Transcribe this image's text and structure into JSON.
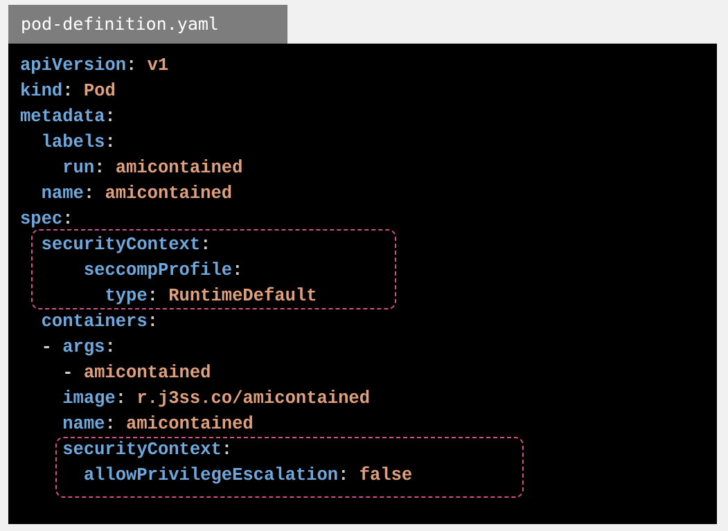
{
  "file_tab": {
    "label": "pod-definition.yaml"
  },
  "colors": {
    "key": "#6fa8dc",
    "value": "#e0a07e",
    "punct": "#d0d0d0",
    "panel_bg": "#000000",
    "tab_bg": "#7d7d7d",
    "highlight": "#d44f8e"
  },
  "code_lines": [
    {
      "indent": "",
      "key": "apiVersion",
      "sep": ":",
      "value": " v1"
    },
    {
      "indent": "",
      "key": "kind",
      "sep": ":",
      "value": " Pod"
    },
    {
      "indent": "",
      "key": "metadata",
      "sep": ":",
      "value": ""
    },
    {
      "indent": "  ",
      "key": "labels",
      "sep": ":",
      "value": ""
    },
    {
      "indent": "    ",
      "key": "run",
      "sep": ":",
      "value": " amicontained"
    },
    {
      "indent": "  ",
      "key": "name",
      "sep": ":",
      "value": " amicontained"
    },
    {
      "indent": "",
      "key": "spec",
      "sep": ":",
      "value": ""
    },
    {
      "indent": "  ",
      "key": "securityContext",
      "sep": ":",
      "value": ""
    },
    {
      "indent": "      ",
      "key": "seccompProfile",
      "sep": ":",
      "value": ""
    },
    {
      "indent": "        ",
      "key": "type",
      "sep": ":",
      "value": " RuntimeDefault"
    },
    {
      "indent": "  ",
      "key": "containers",
      "sep": ":",
      "value": ""
    },
    {
      "indent": "  - ",
      "key": "args",
      "sep": ":",
      "value": ""
    },
    {
      "indent": "    - ",
      "key": "",
      "sep": "",
      "value": "amicontained"
    },
    {
      "indent": "    ",
      "key": "image",
      "sep": ":",
      "value": " r.j3ss.co/amicontained"
    },
    {
      "indent": "    ",
      "key": "name",
      "sep": ":",
      "value": " amicontained"
    },
    {
      "indent": "    ",
      "key": "securityContext",
      "sep": ":",
      "value": ""
    },
    {
      "indent": "      ",
      "key": "allowPrivilegeEscalation",
      "sep": ":",
      "value": " false"
    }
  ]
}
